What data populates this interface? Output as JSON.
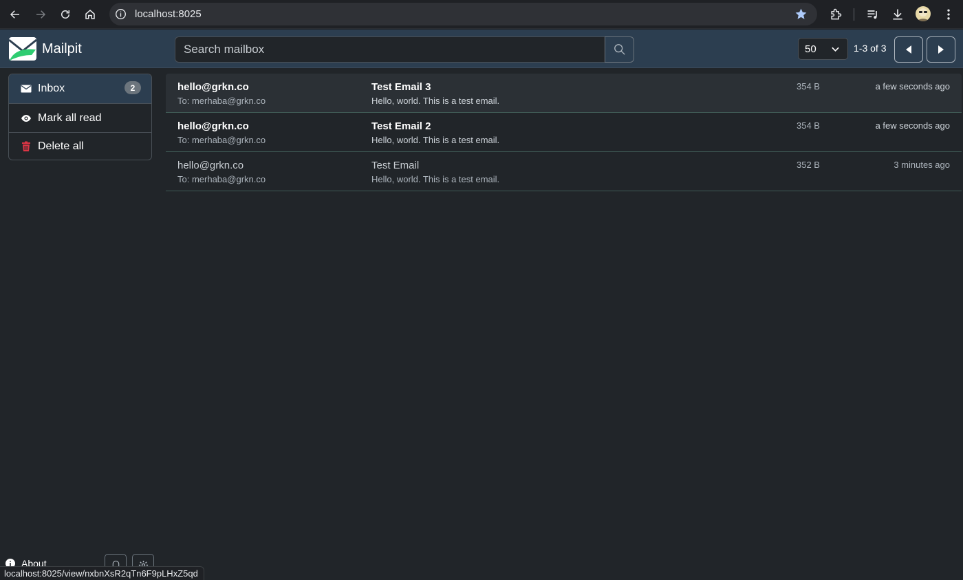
{
  "browser": {
    "url": "localhost:8025",
    "icons": [
      "back-icon",
      "forward-icon",
      "reload-icon",
      "home-icon",
      "site-info-icon",
      "bookmark-star-icon",
      "extensions-icon",
      "media-controls-icon",
      "downloads-icon",
      "profile-avatar",
      "menu-icon"
    ]
  },
  "header": {
    "brand": "Mailpit",
    "search_placeholder": "Search mailbox",
    "per_page": "50",
    "paging": "1-3 of 3"
  },
  "sidebar": {
    "inbox": {
      "label": "Inbox",
      "count": "2"
    },
    "mark_all_read": "Mark all read",
    "delete_all": "Delete all",
    "about": "About"
  },
  "messages": [
    {
      "from": "hello@grkn.co",
      "to": "To: merhaba@grkn.co",
      "subject": "Test Email 3",
      "snippet": "Hello, world. This is a test email.",
      "size": "354 B",
      "time": "a few seconds ago",
      "unread": true
    },
    {
      "from": "hello@grkn.co",
      "to": "To: merhaba@grkn.co",
      "subject": "Test Email 2",
      "snippet": "Hello, world. This is a test email.",
      "size": "354 B",
      "time": "a few seconds ago",
      "unread": true
    },
    {
      "from": "hello@grkn.co",
      "to": "To: merhaba@grkn.co",
      "subject": "Test Email",
      "snippet": "Hello, world. This is a test email.",
      "size": "352 B",
      "time": "3 minutes ago",
      "unread": false
    }
  ],
  "status_bar": "localhost:8025/view/nxbnXsR2qTn6F9pLHxZ5qd",
  "colors": {
    "header_bg": "#2c3e50",
    "page_bg": "#212529",
    "delete_red": "#dc3545",
    "logo_green": "#2ecc71"
  }
}
